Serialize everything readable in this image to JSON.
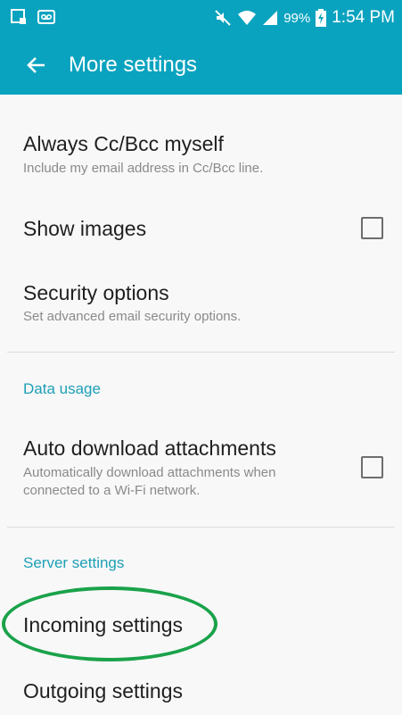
{
  "status_bar": {
    "battery_percent": "99%",
    "time": "1:54 PM",
    "icons": [
      "notification-icon",
      "voicemail-icon",
      "mute-icon",
      "wifi-icon",
      "signal-icon",
      "battery-charging-icon"
    ]
  },
  "app_bar": {
    "title": "More settings",
    "back_icon": "back-arrow-icon"
  },
  "items": {
    "always_cc": {
      "title": "Always Cc/Bcc myself",
      "subtitle": "Include my email address in Cc/Bcc line."
    },
    "show_images": {
      "title": "Show images",
      "checked": false
    },
    "security": {
      "title": "Security options",
      "subtitle": "Set advanced email security options."
    },
    "data_usage_header": "Data usage",
    "auto_download": {
      "title": "Auto download attachments",
      "subtitle_line1": "Automatically download attachments when",
      "subtitle_line2": "connected to a Wi-Fi network.",
      "checked": false
    },
    "server_header": "Server settings",
    "incoming": {
      "title": "Incoming settings"
    },
    "outgoing": {
      "title": "Outgoing settings"
    }
  },
  "colors": {
    "accent": "#0aa3bf",
    "section_header": "#1c9fb6",
    "highlight": "#1aa24a"
  }
}
